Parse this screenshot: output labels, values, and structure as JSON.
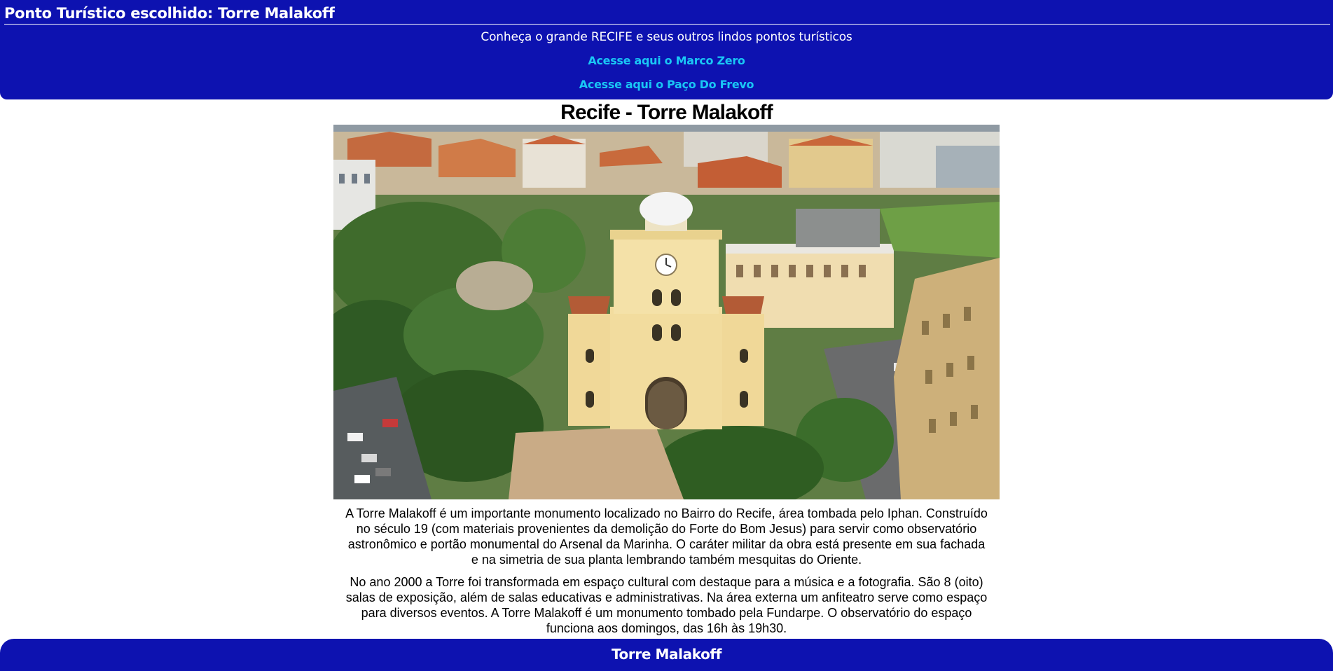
{
  "header": {
    "title": "Ponto Turístico escolhido: Torre Malakoff",
    "subtitle": "Conheça o grande RECIFE e seus outros lindos pontos turísticos",
    "links": [
      {
        "label": "Acesse aqui o Marco Zero"
      },
      {
        "label": "Acesse aqui o Paço Do Frevo"
      }
    ],
    "background_color": "#0d12b0",
    "link_color": "#19c7f5"
  },
  "main": {
    "title": "Recife - Torre Malakoff",
    "image_subject": "aerial-photo-torre-malakoff",
    "paragraphs": [
      "A Torre Malakoff é um importante monumento localizado no Bairro do Recife, área tombada pelo Iphan. Construído no século 19 (com materiais provenientes da demolição do Forte do Bom Jesus) para servir como observatório astronômico e portão monumental do Arsenal da Marinha. O caráter militar da obra está presente em sua fachada e na simetria de sua planta lembrando também mesquitas do Oriente.",
      "No ano 2000 a Torre foi transformada em espaço cultural com destaque para a música e a fotografia. São 8 (oito) salas de exposição, além de salas educativas e administrativas. Na área externa um anfiteatro serve como espaço para diversos eventos. A Torre Malakoff é um monumento tombado pela Fundarpe. O observatório do espaço funciona aos domingos, das 16h às 19h30."
    ]
  },
  "footer": {
    "title": "Torre Malakoff"
  }
}
